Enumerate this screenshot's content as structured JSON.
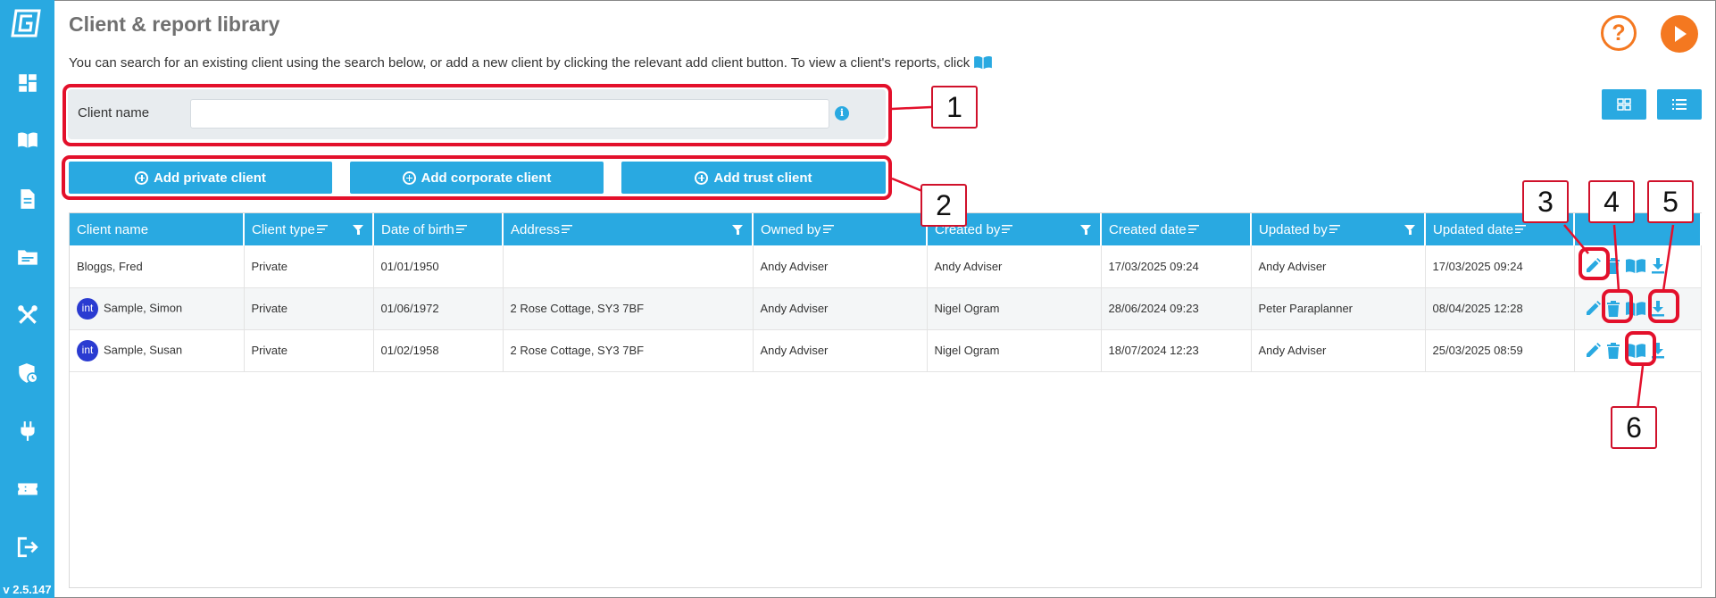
{
  "app": {
    "title": "Client & report library",
    "version": "v 2.5.147",
    "intro": "You can search for an existing client using the search below, or add a new client by clicking the relevant add client button. To view a client's reports, click"
  },
  "sidebar": {
    "items": [
      {
        "icon": "dashboard-icon"
      },
      {
        "icon": "book-open-icon"
      },
      {
        "icon": "document-icon"
      },
      {
        "icon": "folder-icon"
      },
      {
        "icon": "tools-icon"
      },
      {
        "icon": "shield-clock-icon"
      },
      {
        "icon": "plug-icon"
      },
      {
        "icon": "ticket-icon"
      },
      {
        "icon": "logout-icon"
      }
    ]
  },
  "search": {
    "label": "Client name",
    "value": "",
    "placeholder": ""
  },
  "buttons": {
    "add_private": "Add private client",
    "add_corporate": "Add corporate client",
    "add_trust": "Add trust client"
  },
  "callouts": [
    "1",
    "2",
    "3",
    "4",
    "5",
    "6"
  ],
  "table": {
    "headers": [
      "Client name",
      "Client type",
      "Date of birth",
      "Address",
      "Owned by",
      "Created by",
      "Created date",
      "Updated by",
      "Updated date",
      ""
    ],
    "rows": [
      {
        "badge": "",
        "name": "Bloggs, Fred",
        "type": "Private",
        "dob": "01/01/1950",
        "address": "",
        "owned": "Andy Adviser",
        "created_by": "Andy Adviser",
        "created_date": "17/03/2025 09:24",
        "updated_by": "Andy Adviser",
        "updated_date": "17/03/2025 09:24"
      },
      {
        "badge": "int",
        "name": "Sample, Simon",
        "type": "Private",
        "dob": "01/06/1972",
        "address": "2 Rose Cottage, SY3 7BF",
        "owned": "Andy Adviser",
        "created_by": "Nigel Ogram",
        "created_date": "28/06/2024 09:23",
        "updated_by": "Peter Paraplanner",
        "updated_date": "08/04/2025 12:28"
      },
      {
        "badge": "int",
        "name": "Sample, Susan",
        "type": "Private",
        "dob": "01/02/1958",
        "address": "2 Rose Cottage, SY3 7BF",
        "owned": "Andy Adviser",
        "created_by": "Nigel Ogram",
        "created_date": "18/07/2024 12:23",
        "updated_by": "Andy Adviser",
        "updated_date": "25/03/2025 08:59"
      }
    ]
  },
  "colors": {
    "accent": "#29a9e1",
    "orange": "#f47820",
    "annotation": "#e3102b",
    "badge": "#2a3bd1"
  }
}
